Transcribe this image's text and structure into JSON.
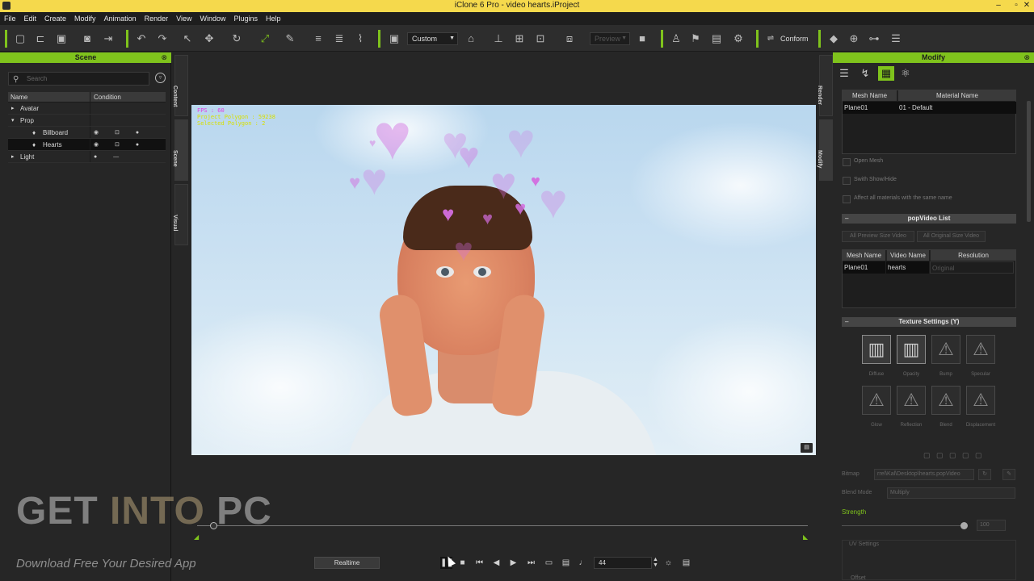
{
  "window": {
    "title": "iClone 6 Pro - video hearts.iProject",
    "minimize": "–",
    "maximize": "▫",
    "close": "✕"
  },
  "menu": [
    "File",
    "Edit",
    "Create",
    "Modify",
    "Animation",
    "Render",
    "View",
    "Window",
    "Plugins",
    "Help"
  ],
  "toolbar": {
    "camera_preset": "Custom",
    "preview_label": "Preview",
    "conform_label": "Conform"
  },
  "scene_panel": {
    "title": "Scene",
    "close": "⊗",
    "search_placeholder": "Search",
    "columns": [
      "Name",
      "Condition"
    ],
    "items": [
      {
        "label": "Avatar",
        "expander": "▸"
      },
      {
        "label": "Prop",
        "expander": "▾"
      },
      {
        "label": "Billboard",
        "icons": "◉ ⊡ ● ▲ —"
      },
      {
        "label": "Hearts",
        "icons": "◉ ⊡ ● ● —"
      },
      {
        "label": "Light",
        "expander": "▸"
      }
    ],
    "side_tabs": [
      "Content",
      "Scene",
      "Visual"
    ]
  },
  "viewport": {
    "hud_fps": "FPS : 60",
    "hud_polygons": "Project Polygon : 59238",
    "hud_selected": "Selected Polygon : 2",
    "note_icon": "▤"
  },
  "timeline": {
    "realtime_label": "Realtime",
    "frame_value": "44"
  },
  "modify_panel": {
    "title": "Modify",
    "close": "⊗",
    "side_tabs": [
      "Render",
      "Modify"
    ],
    "material_table": {
      "columns": [
        "Mesh Name",
        "Material Name"
      ],
      "rows": [
        [
          "Plane01",
          "01 - Default"
        ]
      ]
    },
    "options": [
      "Open Mesh",
      "Swith Show/Hide",
      "Affect all materials with the same name"
    ],
    "popvideo": {
      "title": "popVideo List",
      "btn_preview": "All Preview Size Video",
      "btn_original": "All Original Size Video",
      "columns": [
        "Mesh Name",
        "Video Name",
        "Resolution"
      ],
      "rows": [
        [
          "Plane01",
          "hearts",
          "Original"
        ]
      ]
    },
    "texture": {
      "title": "Texture Settings  (Y)",
      "slots_row1": [
        "Diffuse",
        "Opacity",
        "Bump",
        "Specular"
      ],
      "slots_row2": [
        "Glow",
        "Reflection",
        "Blend",
        "Displacement"
      ]
    },
    "bitmap_label": "Bitmap",
    "bitmap_value": "rrel\\Kal\\Desktop\\hearts.popVideo",
    "blend_mode_label": "Blend Mode",
    "blend_mode_value": "Multiply",
    "strength_label": "Strength",
    "strength_value": "100",
    "uv_settings_label": "UV Settings",
    "offset_label": "Offset"
  },
  "watermark": {
    "get": "GET ",
    "into": "INTO",
    "pc": " PC",
    "tagline": "Download Free Your Desired App"
  },
  "colors": {
    "accent_green": "#7fc31c",
    "title_yellow": "#f5d94c",
    "heart_pink": "#d36ee0"
  }
}
